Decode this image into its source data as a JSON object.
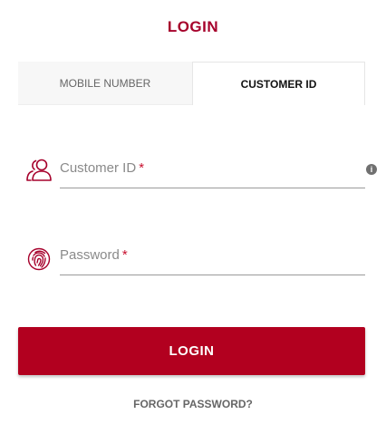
{
  "header": {
    "title": "LOGIN"
  },
  "tabs": [
    {
      "label": "MOBILE NUMBER",
      "active": false
    },
    {
      "label": "CUSTOMER ID",
      "active": true
    }
  ],
  "form": {
    "customer_id": {
      "label": "Customer ID",
      "required_mark": "*",
      "value": "",
      "icon": "users-icon",
      "help_icon": "info-icon",
      "help_glyph": "i"
    },
    "password": {
      "label": "Password",
      "required_mark": "*",
      "value": "",
      "icon": "fingerprint-icon"
    }
  },
  "actions": {
    "login_label": "LOGIN",
    "forgot_label": "FORGOT PASSWORD?"
  },
  "colors": {
    "brand": "#a6002b",
    "brand_button": "#b2001f",
    "required": "#c8102e",
    "muted_text": "#666666"
  }
}
